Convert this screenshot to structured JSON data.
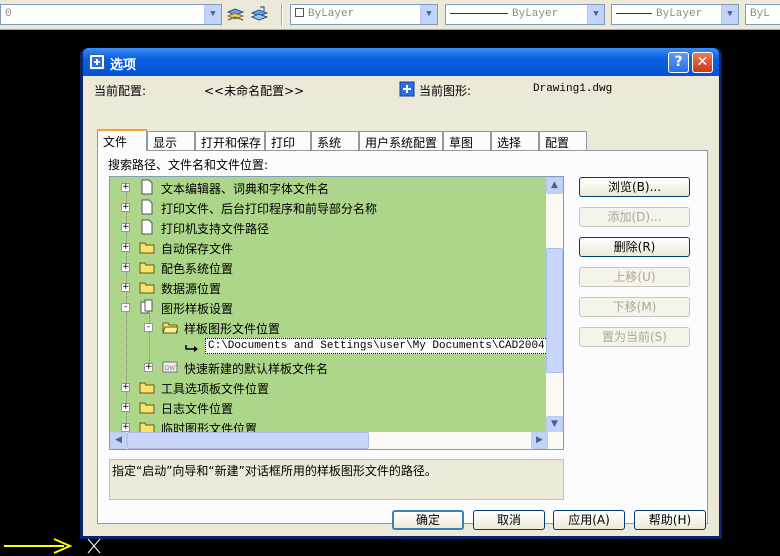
{
  "toolbar": {
    "layer_value": "0",
    "color_value": "ByLayer",
    "linetype_value": "ByLayer",
    "lineweight_value": "ByLayer",
    "plotstyle_value": "ByL"
  },
  "dialog": {
    "title": "选项",
    "help_glyph": "?",
    "close_glyph": "✕",
    "profile_label": "当前配置:",
    "profile_value": "<<未命名配置>>",
    "drawing_label": "当前图形:",
    "drawing_value": "Drawing1.dwg",
    "tabs": [
      {
        "label": "文件",
        "active": true
      },
      {
        "label": "显示"
      },
      {
        "label": "打开和保存"
      },
      {
        "label": "打印"
      },
      {
        "label": "系统"
      },
      {
        "label": "用户系统配置"
      },
      {
        "label": "草图"
      },
      {
        "label": "选择"
      },
      {
        "label": "配置"
      }
    ],
    "tree_heading": "搜索路径、文件名和文件位置:",
    "tree_items": [
      {
        "label": "文本编辑器、词典和字体文件名",
        "expander": "+",
        "icon": "document-icon"
      },
      {
        "label": "打印文件、后台打印程序和前导部分名称",
        "expander": "+",
        "icon": "document-icon"
      },
      {
        "label": "打印机支持文件路径",
        "expander": "+",
        "icon": "document-icon"
      },
      {
        "label": "自动保存文件",
        "expander": "+",
        "icon": "folder-icon"
      },
      {
        "label": "配色系统位置",
        "expander": "+",
        "icon": "folder-icon"
      },
      {
        "label": "数据源位置",
        "expander": "+",
        "icon": "folder-icon"
      },
      {
        "label": "图形样板设置",
        "expander": "-",
        "icon": "template-icon"
      },
      {
        "label": "样板图形文件位置",
        "expander": "-",
        "icon": "folder-icon"
      },
      {
        "label": "C:\\Documents and Settings\\user\\My Documents\\CAD2004",
        "icon": "path-arrow-icon",
        "selected": true
      },
      {
        "label": "快速新建的默认样板文件名",
        "expander": "+",
        "icon": "dwt-icon"
      },
      {
        "label": "工具选项板文件位置",
        "expander": "+",
        "icon": "folder-icon"
      },
      {
        "label": "日志文件位置",
        "expander": "+",
        "icon": "folder-icon"
      },
      {
        "label": "临时图形文件位置",
        "expander": "+",
        "icon": "folder-icon"
      }
    ],
    "description": "指定“启动”向导和“新建”对话框所用的样板图形文件的路径。",
    "side_buttons": {
      "browse": "浏览(B)...",
      "add": "添加(D)...",
      "remove": "删除(R)",
      "move_up": "上移(U)",
      "move_down": "下移(M)",
      "set_current": "置为当前(S)"
    },
    "bottom_buttons": {
      "ok": "确定",
      "cancel": "取消",
      "apply": "应用(A)",
      "help": "帮助(H)"
    }
  },
  "colors": {
    "tree_background": "#aed68a",
    "title_bar": "#0452d6",
    "arrow": "#ffff00"
  }
}
